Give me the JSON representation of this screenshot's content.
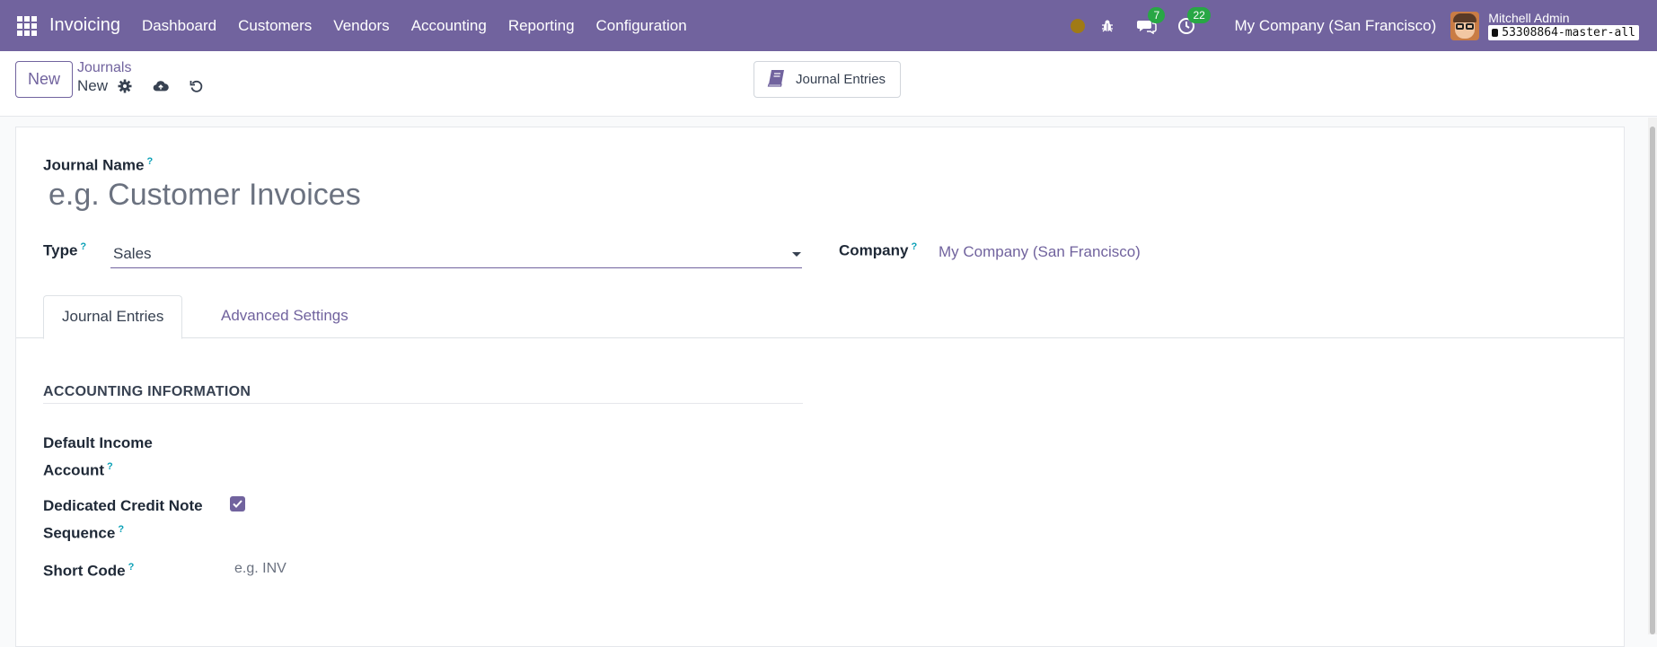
{
  "navbar": {
    "app_name": "Invoicing",
    "menu": [
      "Dashboard",
      "Customers",
      "Vendors",
      "Accounting",
      "Reporting",
      "Configuration"
    ],
    "messages_count": "7",
    "activities_count": "22",
    "company": "My Company (San Francisco)",
    "user_name": "Mitchell Admin",
    "database": "53308864-master-all"
  },
  "control_panel": {
    "new_button": "New",
    "breadcrumb_parent": "Journals",
    "breadcrumb_current": "New",
    "smart_button": "Journal Entries"
  },
  "form": {
    "journal_name_label": "Journal Name",
    "journal_name_placeholder": "e.g. Customer Invoices",
    "help_mark": "?",
    "type_label": "Type",
    "type_value": "Sales",
    "company_label": "Company",
    "company_value": "My Company (San Francisco)"
  },
  "tabs": [
    "Journal Entries",
    "Advanced Settings"
  ],
  "accounting": {
    "section_title": "ACCOUNTING INFORMATION",
    "default_income_label": "Default Income Account",
    "credit_note_label": "Dedicated Credit Note Sequence",
    "credit_note_checked": true,
    "short_code_label": "Short Code",
    "short_code_placeholder": "e.g. INV"
  },
  "colors": {
    "brand": "#71639e",
    "help": "#0aa0b6",
    "badge": "#28a745"
  }
}
